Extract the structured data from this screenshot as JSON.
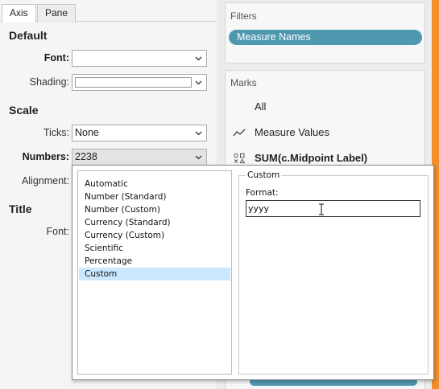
{
  "tabs": [
    {
      "label": "Axis",
      "active": true
    },
    {
      "label": "Pane",
      "active": false
    }
  ],
  "default_section": {
    "heading": "Default",
    "font_label": "Font:",
    "font_value": "",
    "shading_label": "Shading:",
    "shading_color": "#ffffff"
  },
  "scale_section": {
    "heading": "Scale",
    "ticks_label": "Ticks:",
    "ticks_value": "None",
    "numbers_label": "Numbers:",
    "numbers_value": "2238",
    "alignment_label": "Alignment:"
  },
  "title_section": {
    "heading": "Title",
    "font_label": "Font:"
  },
  "filters": {
    "title": "Filters",
    "pill": "Measure Names",
    "pill_color": "#4e98b0"
  },
  "marks": {
    "title": "Marks",
    "rows": [
      {
        "label": "All",
        "icon": "none"
      },
      {
        "label": "Measure Values",
        "icon": "line-mark-icon"
      },
      {
        "label": "SUM(c.Midpoint Label)",
        "icon": "shape-mark-icon"
      }
    ]
  },
  "number_format": {
    "options": [
      "Automatic",
      "Number (Standard)",
      "Number (Custom)",
      "Currency (Standard)",
      "Currency (Custom)",
      "Scientific",
      "Percentage",
      "Custom"
    ],
    "selected": "Custom",
    "custom_group_title": "Custom",
    "format_label": "Format:",
    "format_value": "yyyy"
  },
  "colors": {
    "accent_orange": "#f28e2b",
    "selection": "#cce8ff"
  }
}
